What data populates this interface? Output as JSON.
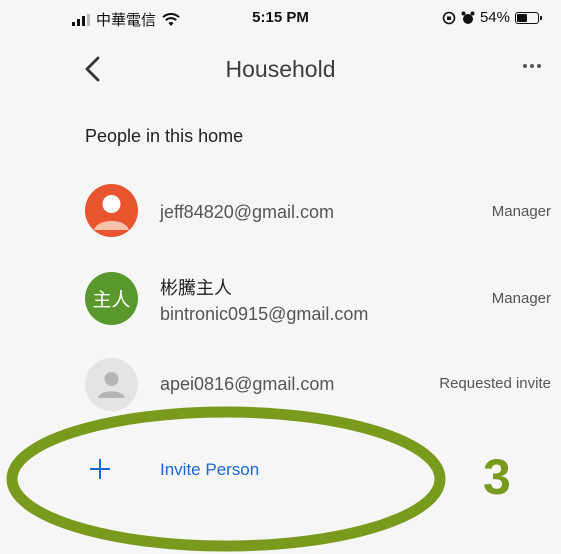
{
  "status_bar": {
    "carrier": "中華電信",
    "time": "5:15 PM",
    "battery": "54%",
    "battery_level": 0.54
  },
  "header": {
    "title": "Household"
  },
  "section": {
    "title": "People in this home"
  },
  "people": [
    {
      "email": "jeff84820@gmail.com",
      "role": "Manager",
      "avatar": "person-icon",
      "avatar_color": "#e8542e"
    },
    {
      "name": "彬騰主人",
      "email": "bintronic0915@gmail.com",
      "role": "Manager",
      "avatar_text": "主人",
      "avatar_color": "#59982d"
    },
    {
      "email": "apei0816@gmail.com",
      "role": "Requested invite",
      "avatar": "person-icon",
      "avatar_color": "#e4e4e4"
    }
  ],
  "invite": {
    "label": "Invite Person"
  },
  "annotation": {
    "number": "3",
    "color": "#7a9a1e"
  },
  "colors": {
    "accent": "#1967d2",
    "background": "#f6f6f6"
  }
}
